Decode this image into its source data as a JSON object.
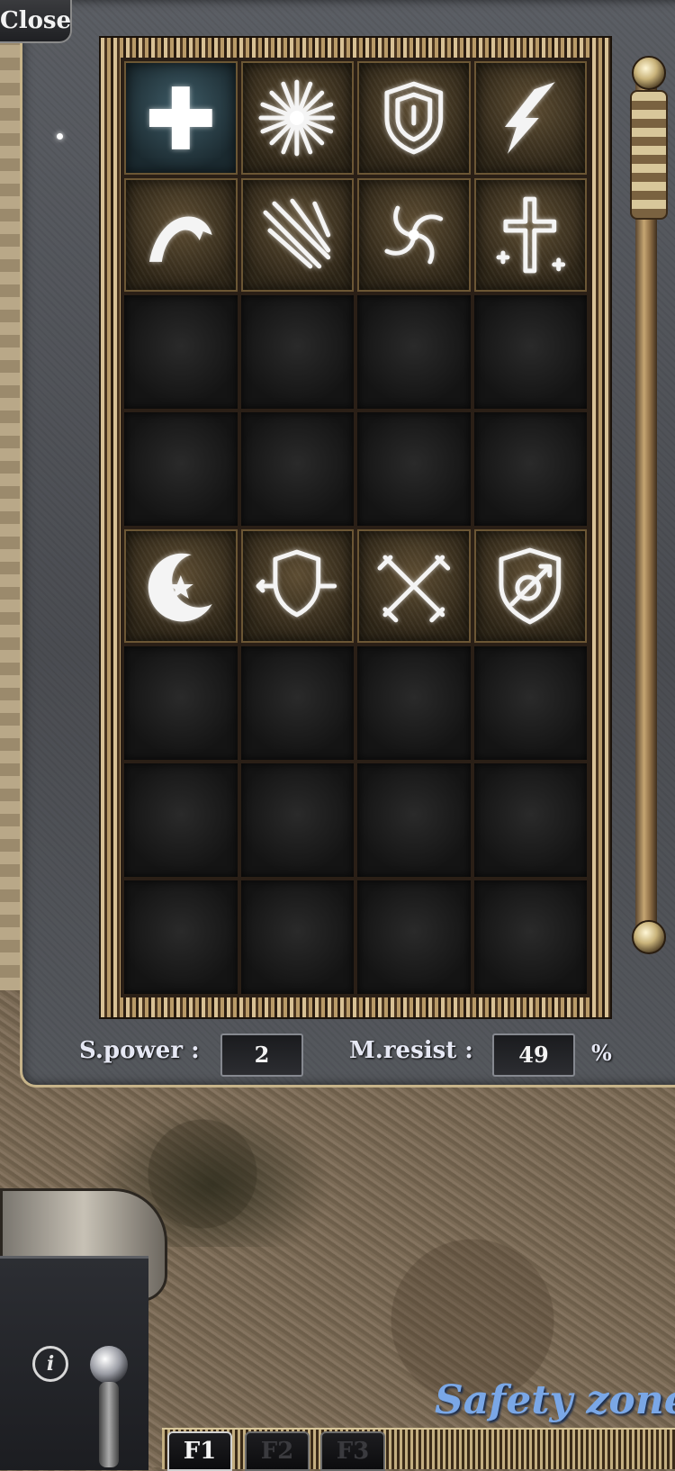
{
  "window": {
    "close_label": "Close"
  },
  "skills": {
    "slots": [
      {
        "icon": "heal-cross-icon",
        "highlight": true
      },
      {
        "icon": "starburst-icon"
      },
      {
        "icon": "shield-icon"
      },
      {
        "icon": "lightning-icon"
      },
      {
        "icon": "wave-swoosh-icon"
      },
      {
        "icon": "slash-strikes-icon"
      },
      {
        "icon": "vortex-icon"
      },
      {
        "icon": "holy-cross-icon"
      },
      {
        "icon": ""
      },
      {
        "icon": ""
      },
      {
        "icon": ""
      },
      {
        "icon": ""
      },
      {
        "icon": ""
      },
      {
        "icon": ""
      },
      {
        "icon": ""
      },
      {
        "icon": ""
      },
      {
        "icon": "moon-star-icon"
      },
      {
        "icon": "shield-arrows-icon"
      },
      {
        "icon": "crossed-swords-icon"
      },
      {
        "icon": "shield-spear-icon"
      },
      {
        "icon": ""
      },
      {
        "icon": ""
      },
      {
        "icon": ""
      },
      {
        "icon": ""
      },
      {
        "icon": ""
      },
      {
        "icon": ""
      },
      {
        "icon": ""
      },
      {
        "icon": ""
      },
      {
        "icon": ""
      },
      {
        "icon": ""
      },
      {
        "icon": ""
      },
      {
        "icon": ""
      }
    ]
  },
  "stats": {
    "spower_label": "S.power :",
    "spower_value": "2",
    "mresist_label": "M.resist :",
    "mresist_value": "49",
    "mresist_unit": "%"
  },
  "status": {
    "zone_text": "Safety zone"
  },
  "hotkeys": {
    "tabs": [
      "F1",
      "F2",
      "F3"
    ],
    "active_index": 0
  },
  "colors": {
    "zone_text": "#7aa7e6",
    "frame_gold": "#c7b48a"
  }
}
